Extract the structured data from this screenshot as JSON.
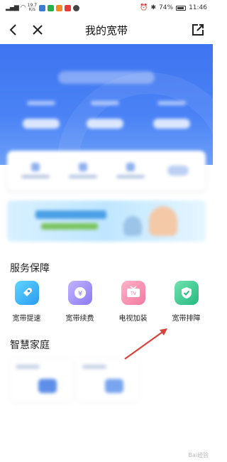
{
  "status_bar": {
    "speed_value": "19.7",
    "speed_unit": "K/s",
    "battery": "74%",
    "time": "11:46"
  },
  "nav": {
    "title": "我的宽带"
  },
  "sections": {
    "service": {
      "title": "服务保障",
      "items": [
        {
          "label": "宽带提速",
          "icon": "rocket-icon"
        },
        {
          "label": "宽带续费",
          "icon": "yen-coin-icon"
        },
        {
          "label": "电视加装",
          "icon": "tv-icon"
        },
        {
          "label": "宽带排障",
          "icon": "shield-check-icon"
        }
      ]
    },
    "smart_home": {
      "title": "智慧家庭"
    }
  },
  "colors": {
    "hero_blue": "#3e74f0",
    "annotation_arrow": "#d9423a"
  },
  "watermark": "Bai经验"
}
